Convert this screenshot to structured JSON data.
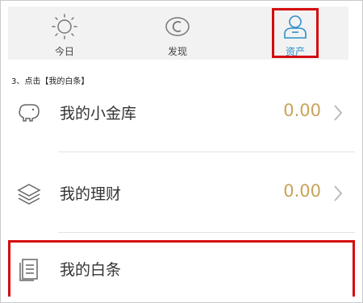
{
  "tabs": [
    {
      "label": "今日",
      "icon": "sun-icon",
      "active": false
    },
    {
      "label": "发现",
      "icon": "compass-icon",
      "active": false
    },
    {
      "label": "资产",
      "icon": "user-icon",
      "active": true
    }
  ],
  "caption": "3、点击【我的白条】",
  "rows": [
    {
      "label": "我的小金库",
      "value": "0.00",
      "icon": "piggy-bank-icon"
    },
    {
      "label": "我的理财",
      "value": "0.00",
      "icon": "layers-icon"
    },
    {
      "label": "我的白条",
      "icon": "document-icon"
    }
  ],
  "colors": {
    "accent": "#2d8fc9",
    "value": "#c9a35a",
    "highlight": "#d40c0c"
  }
}
